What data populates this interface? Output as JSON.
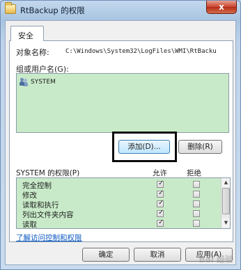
{
  "window": {
    "title": "RtBackup 的权限",
    "close_label": "x"
  },
  "tabs": [
    {
      "label": "安全"
    }
  ],
  "object": {
    "label": "对象名称:",
    "value": "C:\\Windows\\System32\\LogFiles\\WMI\\RtBacku"
  },
  "group": {
    "label": "组或用户名(G):",
    "users": [
      {
        "name": "SYSTEM",
        "icon": "users-icon"
      }
    ]
  },
  "buttons": {
    "add": "添加(D)...",
    "remove": "删除(R)",
    "ok": "确定",
    "cancel": "取消",
    "apply": "应用(A)"
  },
  "permissions": {
    "header": "SYSTEM 的权限(P)",
    "allow_label": "允许",
    "deny_label": "拒绝",
    "items": [
      {
        "name": "完全控制",
        "allow": true,
        "deny": false
      },
      {
        "name": "修改",
        "allow": true,
        "deny": false
      },
      {
        "name": "读取和执行",
        "allow": true,
        "deny": false
      },
      {
        "name": "列出文件夹内容",
        "allow": true,
        "deny": false
      },
      {
        "name": "读取",
        "allow": true,
        "deny": false
      }
    ]
  },
  "link": "了解访问控制和权限",
  "watermark": "Bai 经验"
}
